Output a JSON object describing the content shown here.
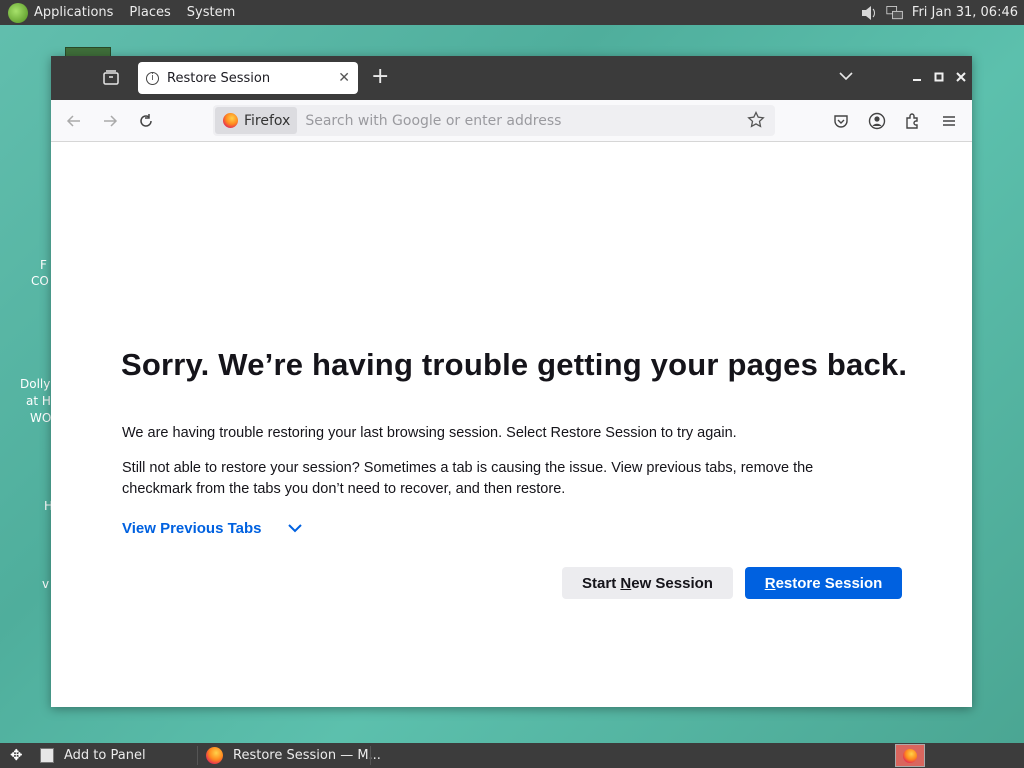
{
  "top_panel": {
    "menus": [
      "Applications",
      "Places",
      "System"
    ],
    "clock": "Fri Jan 31, 06:46"
  },
  "desktop": {
    "labels": [
      "F",
      "CO",
      "Dolly",
      "at H",
      "WO",
      "H",
      "v"
    ]
  },
  "browser": {
    "tab": {
      "title": "Restore Session"
    },
    "urlbar": {
      "identity_label": "Firefox",
      "placeholder": "Search with Google or enter address"
    }
  },
  "content": {
    "heading": "Sorry. We’re having trouble getting your pages back.",
    "para1": "We are having trouble restoring your last browsing session. Select Restore Session to try again.",
    "para2": "Still not able to restore your session? Sometimes a tab is causing the issue. View previous tabs, remove the checkmark from the tabs you don’t need to recover, and then restore.",
    "view_previous_tabs": "View Previous Tabs",
    "start_new_session": {
      "pre": "Start ",
      "accel": "N",
      "post": "ew Session"
    },
    "restore_session": {
      "accel": "R",
      "post": "estore Session"
    }
  },
  "bottom_panel": {
    "add_to_panel": "Add to Panel",
    "task_title": "Restore Session — M..."
  },
  "colors": {
    "accent": "#0061e0",
    "panel": "#3c3c3c",
    "desktop": "#5cbba9"
  }
}
